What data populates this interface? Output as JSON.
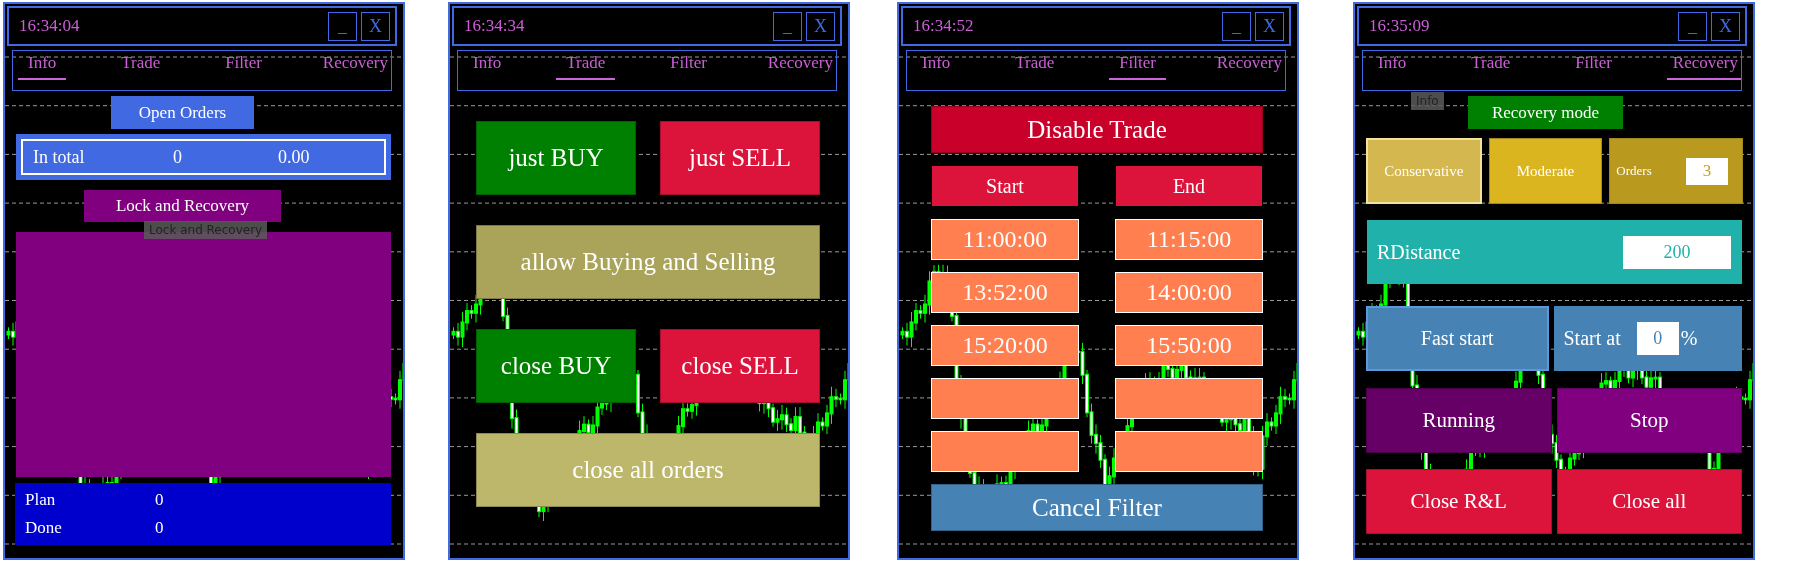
{
  "panels": [
    {
      "time": "16:34:04",
      "minimize_label": "_",
      "close_label": "X",
      "tabs": [
        {
          "label": "Info",
          "selected": true
        },
        {
          "label": "Trade",
          "selected": false
        },
        {
          "label": "Filter",
          "selected": false
        },
        {
          "label": "Recovery",
          "selected": false
        }
      ],
      "view": {
        "kind": "info",
        "open_orders": "Open Orders",
        "total": {
          "label": "In total",
          "count": "0",
          "amount": "0.00"
        },
        "lock_title": "Lock and Recovery",
        "tooltip": "Lock and Recovery",
        "stats": [
          {
            "label": "Plan",
            "value": "0"
          },
          {
            "label": "Done",
            "value": "0"
          }
        ]
      }
    },
    {
      "time": "16:34:34",
      "minimize_label": "_",
      "close_label": "X",
      "tabs": [
        {
          "label": "Info",
          "selected": false
        },
        {
          "label": "Trade",
          "selected": true
        },
        {
          "label": "Filter",
          "selected": false
        },
        {
          "label": "Recovery",
          "selected": false
        }
      ],
      "view": {
        "kind": "trade",
        "rows": [
          {
            "buttons": [
              {
                "label": "just BUY",
                "color": "#008000"
              },
              {
                "label": "just SELL",
                "color": "#dc143c"
              }
            ]
          },
          {
            "buttons": [
              {
                "label": "allow Buying and Selling",
                "color": "#aaa35a"
              }
            ]
          },
          {
            "buttons": [
              {
                "label": "close BUY",
                "color": "#008000"
              },
              {
                "label": "close SELL",
                "color": "#dc143c"
              }
            ]
          },
          {
            "buttons": [
              {
                "label": "close all orders",
                "color": "#bdb76b"
              }
            ]
          }
        ]
      }
    },
    {
      "time": "16:34:52",
      "minimize_label": "_",
      "close_label": "X",
      "tabs": [
        {
          "label": "Info",
          "selected": false
        },
        {
          "label": "Trade",
          "selected": false
        },
        {
          "label": "Filter",
          "selected": true
        },
        {
          "label": "Recovery",
          "selected": false
        }
      ],
      "view": {
        "kind": "filter",
        "disable_button": "Disable Trade",
        "start_header": "Start",
        "end_header": "End",
        "slots": [
          {
            "kind": "time",
            "start": "11:00:00",
            "end": "11:15:00"
          },
          {
            "kind": "time",
            "start": "13:52:00",
            "end": "14:00:00"
          },
          {
            "kind": "time",
            "start": "15:20:00",
            "end": "15:50:00"
          },
          {
            "kind": "blank"
          },
          {
            "kind": "blank"
          }
        ],
        "cancel_button": "Cancel Filter"
      }
    },
    {
      "time": "16:35:09",
      "minimize_label": "_",
      "close_label": "X",
      "tabs": [
        {
          "label": "Info",
          "selected": false
        },
        {
          "label": "Trade",
          "selected": false
        },
        {
          "label": "Filter",
          "selected": false
        },
        {
          "label": "Recovery",
          "selected": true
        }
      ],
      "view": {
        "kind": "recovery",
        "tooltip": "Info",
        "mode_title": "Recovery mode",
        "modes": [
          {
            "label": "Conservative",
            "selected": true,
            "color": "#d4b84f"
          },
          {
            "label": "Moderate",
            "selected": false,
            "color": "#dab520"
          }
        ],
        "orders": {
          "label": "Orders",
          "value": "3"
        },
        "rdistance": {
          "label": "RDistance",
          "value": "200"
        },
        "fast_start": "Fast start",
        "start_at": {
          "label": "Start at",
          "value": "0",
          "unit": "%"
        },
        "action_rows": [
          {
            "buttons": [
              {
                "label": "Running",
                "color": "#660066"
              },
              {
                "label": "Stop",
                "color": "#800080"
              }
            ]
          },
          {
            "buttons": [
              {
                "label": "Close R&L",
                "color": "#dc143c"
              },
              {
                "label": "Close all",
                "color": "#dc143c"
              }
            ]
          }
        ]
      }
    }
  ]
}
